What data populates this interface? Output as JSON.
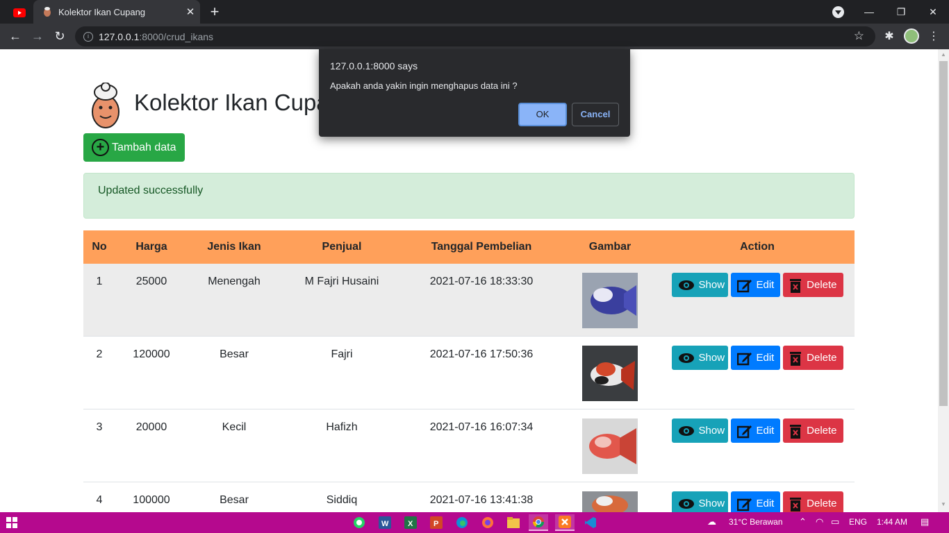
{
  "browser": {
    "tab_title": "Kolektor Ikan Cupang",
    "url_host": "127.0.0.1",
    "url_path": ":8000/crud_ikans"
  },
  "page": {
    "title": "Kolektor Ikan Cupang",
    "add_button": "Tambah data",
    "alert": "Updated successfully",
    "columns": [
      "No",
      "Harga",
      "Jenis Ikan",
      "Penjual",
      "Tanggal Pembelian",
      "Gambar",
      "Action"
    ],
    "rows": [
      {
        "no": "1",
        "harga": "25000",
        "jenis": "Menengah",
        "penjual": "M Fajri Husaini",
        "tanggal": "2021-07-16 18:33:30"
      },
      {
        "no": "2",
        "harga": "120000",
        "jenis": "Besar",
        "penjual": "Fajri",
        "tanggal": "2021-07-16 17:50:36"
      },
      {
        "no": "3",
        "harga": "20000",
        "jenis": "Kecil",
        "penjual": "Hafizh",
        "tanggal": "2021-07-16 16:07:34"
      },
      {
        "no": "4",
        "harga": "100000",
        "jenis": "Besar",
        "penjual": "Siddiq",
        "tanggal": "2021-07-16 13:41:38"
      }
    ],
    "actions": {
      "show": "Show",
      "edit": "Edit",
      "delete": "Delete"
    }
  },
  "dialog": {
    "origin": "127.0.0.1:8000 says",
    "message": "Apakah anda yakin ingin menghapus data ini ?",
    "ok": "OK",
    "cancel": "Cancel"
  },
  "taskbar": {
    "weather": "31°C  Berawan",
    "lang": "ENG",
    "time": "1:44 AM"
  },
  "colors": {
    "table_header": "#ffa05a",
    "add_button": "#28a745",
    "show_button": "#17a2b8",
    "edit_button": "#007bff",
    "delete_button": "#dc3545",
    "taskbar": "#b5098e"
  }
}
